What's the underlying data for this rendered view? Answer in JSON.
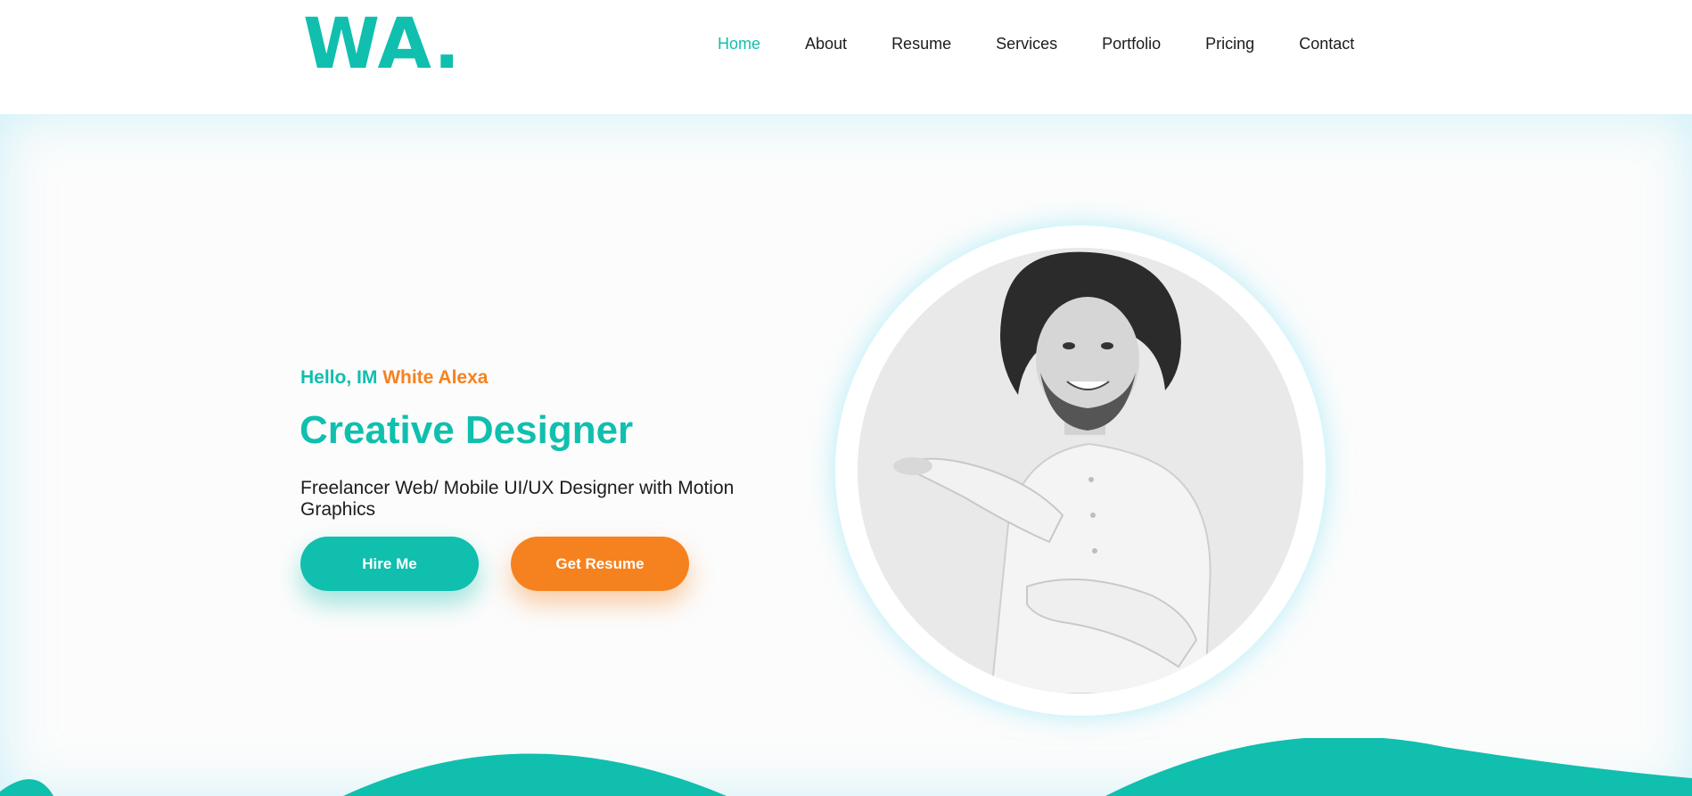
{
  "logo": {
    "text": "WA."
  },
  "nav": {
    "items": [
      {
        "label": "Home",
        "active": true
      },
      {
        "label": "About",
        "active": false
      },
      {
        "label": "Resume",
        "active": false
      },
      {
        "label": "Services",
        "active": false
      },
      {
        "label": "Portfolio",
        "active": false
      },
      {
        "label": "Pricing",
        "active": false
      },
      {
        "label": "Contact",
        "active": false
      }
    ]
  },
  "hero": {
    "greeting_prefix": "Hello, IM ",
    "greeting_name": "White Alexa",
    "title": "Creative Designer",
    "subtitle": "Freelancer Web/ Mobile UI/UX Designer with Motion Graphics",
    "hire_button": "Hire Me",
    "resume_button": "Get Resume"
  },
  "colors": {
    "accent": "#10bfae",
    "secondary": "#f5821f",
    "text": "#1c1c1c",
    "background": "#fcfcfc"
  }
}
